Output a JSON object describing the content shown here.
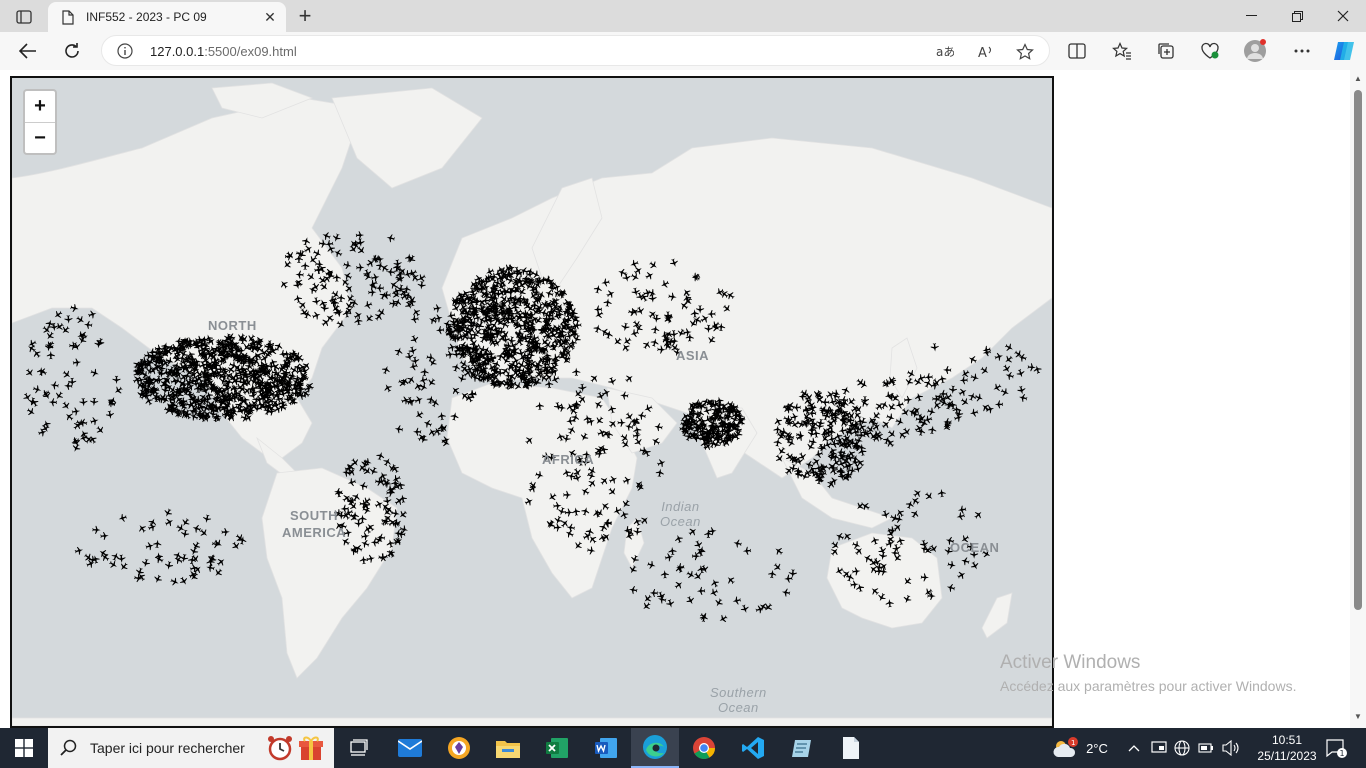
{
  "browser": {
    "tab_title": "INF552 - 2023 - PC 09",
    "url_host": "127.0.0.1",
    "url_rest": ":5500/ex09.html"
  },
  "map": {
    "zoom_in": "+",
    "zoom_out": "−",
    "labels": {
      "north": "NORTH",
      "asia": "ASIA",
      "africa": "AFRICA",
      "south_america_1": "SOUTH",
      "south_america_2": "AMERICA",
      "indian_ocean": "Indian\nOcean",
      "ocean": "OCEAN",
      "southern_ocean": "Southern\nOcean"
    },
    "marker_icon": "plane-icon"
  },
  "watermark": {
    "title": "Activer Windows",
    "subtitle": "Accédez aux paramètres pour activer Windows."
  },
  "taskbar": {
    "search_placeholder": "Taper ici pour rechercher",
    "weather_temp": "2°C",
    "weather_badge": "1",
    "time": "10:51",
    "date": "25/11/2023",
    "notification_count": "1"
  },
  "colors": {
    "ocean": "#d4d9dc",
    "land": "#f2f2f0",
    "plane": "#000000",
    "taskbar": "#1f2733"
  }
}
